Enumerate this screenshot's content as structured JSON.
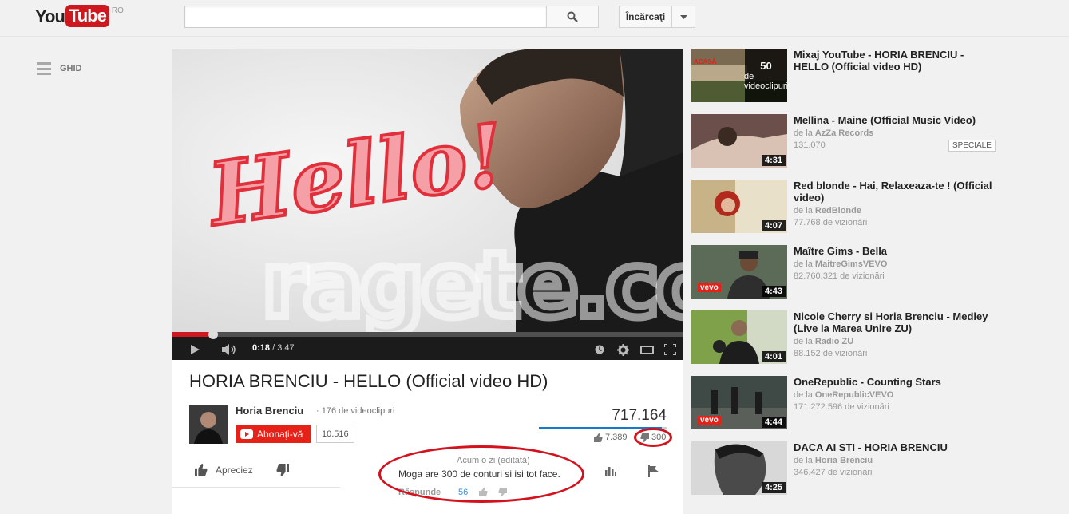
{
  "header": {
    "logo_you": "You",
    "logo_tube": "Tube",
    "logo_country": "RO",
    "search_placeholder": "",
    "upload_label": "Încărcaţi"
  },
  "guide": {
    "label": "GHID"
  },
  "player": {
    "watermark": "ragete.com",
    "video_text": "Hello!",
    "time_current": "0:18",
    "time_total": "3:47",
    "progress_fraction": 0.08
  },
  "video": {
    "title": "HORIA BRENCIU - HELLO (Official video HD)",
    "channel": "Horia Brenciu",
    "video_count": "· 176 de videoclipuri",
    "subscribe_label": "Abonaţi-vă",
    "subscriber_count": "10.516",
    "views": "717.164",
    "likes": "7.389",
    "dislikes": "300",
    "like_fraction": 0.96,
    "like_label": "Apreciez"
  },
  "comment": {
    "time": "Acum o zi (editată)",
    "text": "Moga are 300 de conturi si isi tot face.",
    "reply_label": "Răspunde",
    "reply_count": "56"
  },
  "related": [
    {
      "title": "Mixaj YouTube - HORIA BRENCIU - HELLO (Official video HD)",
      "mix_count": "50",
      "mix_label": "de videoclipuri",
      "thumb_label": "ACASĂ"
    },
    {
      "title": "Mellina - Maine (Official Music Video)",
      "by_prefix": "de la",
      "channel": "AzZa Records",
      "views": "131.070",
      "duration": "4:31",
      "badge": "SPECIALE"
    },
    {
      "title": "Red blonde - Hai, Relaxeaza-te ! (Official video)",
      "by_prefix": "de la",
      "channel": "RedBlonde",
      "views": "77.768 de vizionări",
      "duration": "4:07"
    },
    {
      "title": "Maître Gims - Bella",
      "by_prefix": "de la",
      "channel": "MaitreGimsVEVO",
      "views": "82.760.321 de vizionări",
      "duration": "4:43",
      "thumb_label": "vevo"
    },
    {
      "title": "Nicole Cherry si Horia Brenciu - Medley (Live la Marea Unire ZU)",
      "by_prefix": "de la",
      "channel": "Radio ZU",
      "views": "88.152 de vizionări",
      "duration": "4:01"
    },
    {
      "title": "OneRepublic - Counting Stars",
      "by_prefix": "de la",
      "channel": "OneRepublicVEVO",
      "views": "171.272.596 de vizionări",
      "duration": "4:44",
      "thumb_label": "vevo"
    },
    {
      "title": "DACA AI STI - HORIA BRENCIU",
      "by_prefix": "de la",
      "channel": "Horia Brenciu",
      "views": "346.427 de vizionări",
      "duration": "4:25"
    }
  ]
}
